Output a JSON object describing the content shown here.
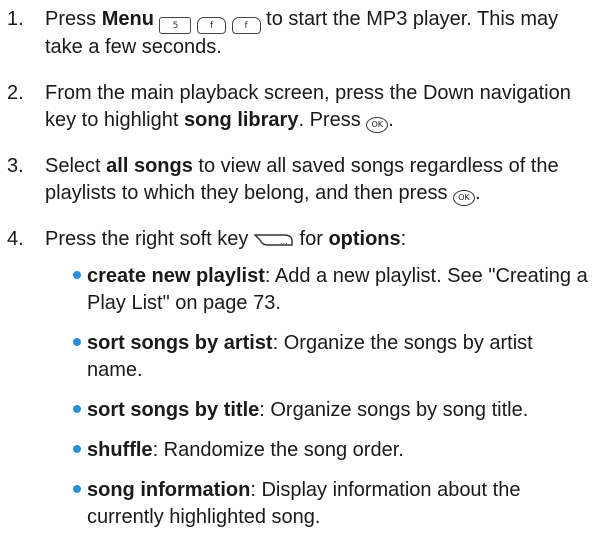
{
  "steps": [
    {
      "num": "1.",
      "pre": "Press ",
      "bold": "Menu",
      "keys": [
        "5",
        "f",
        "f"
      ],
      "post": " to start the MP3 player. This may take a few seconds."
    },
    {
      "num": "2.",
      "pre": "From the main playback screen, press the Down navigation key to highlight ",
      "bold": "song library",
      "mid": ". Press ",
      "ok": "OK",
      "post": "."
    },
    {
      "num": "3.",
      "pre": "Select ",
      "bold": "all songs",
      "mid": " to view all saved songs regardless of the playlists to which they belong, and then press ",
      "ok": "OK",
      "post": "."
    },
    {
      "num": "4.",
      "pre": "Press the right soft key ",
      "mid": " for ",
      "bold": "options",
      "post": ":",
      "options": [
        {
          "term": "create new playlist",
          "desc": ": Add a new playlist. See \"Creating a Play List\" on page 73."
        },
        {
          "term": "sort songs by artist",
          "desc": ": Organize the songs by artist name."
        },
        {
          "term": "sort songs by title",
          "desc": ": Organize songs by song title."
        },
        {
          "term": "shuffle",
          "desc": ": Randomize the song order."
        },
        {
          "term": "song information",
          "desc": ": Display information about the currently highlighted song."
        }
      ]
    }
  ],
  "colors": {
    "bullet": "#2a8fd6",
    "text": "#1a1a1a"
  },
  "icons": {
    "ok": "ok-key-icon",
    "soft": "right-soft-key-icon",
    "menu_keys": [
      "key-5-icon",
      "key-f-icon"
    ]
  }
}
